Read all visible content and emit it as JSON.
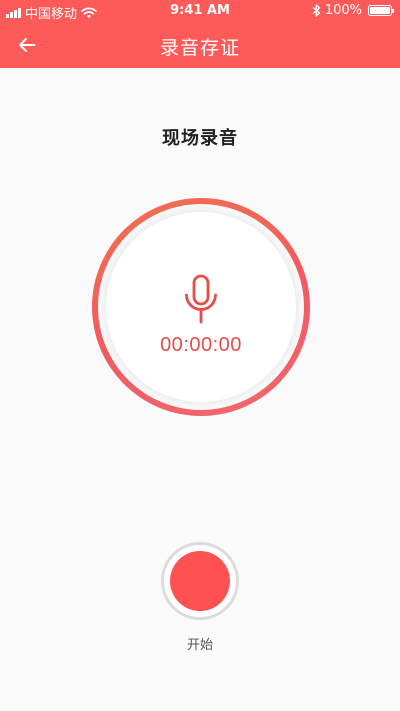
{
  "status_bar": {
    "carrier": "中国移动",
    "time": "9:41 AM",
    "battery": "100%",
    "icons": [
      "signal-icon",
      "wifi-icon",
      "bluetooth-icon",
      "battery-icon"
    ]
  },
  "nav": {
    "back_icon": "arrow-left-icon",
    "title": "录音存证"
  },
  "main": {
    "heading": "现场录音",
    "mic_icon": "microphone-icon",
    "timer": "00:00:00",
    "start_label": "开始"
  },
  "colors": {
    "accent": "#ff5a5a",
    "ring": "#f25a62",
    "record_button": "#ff5152",
    "timer_text": "#e94b4b",
    "background": "#fafafa"
  }
}
